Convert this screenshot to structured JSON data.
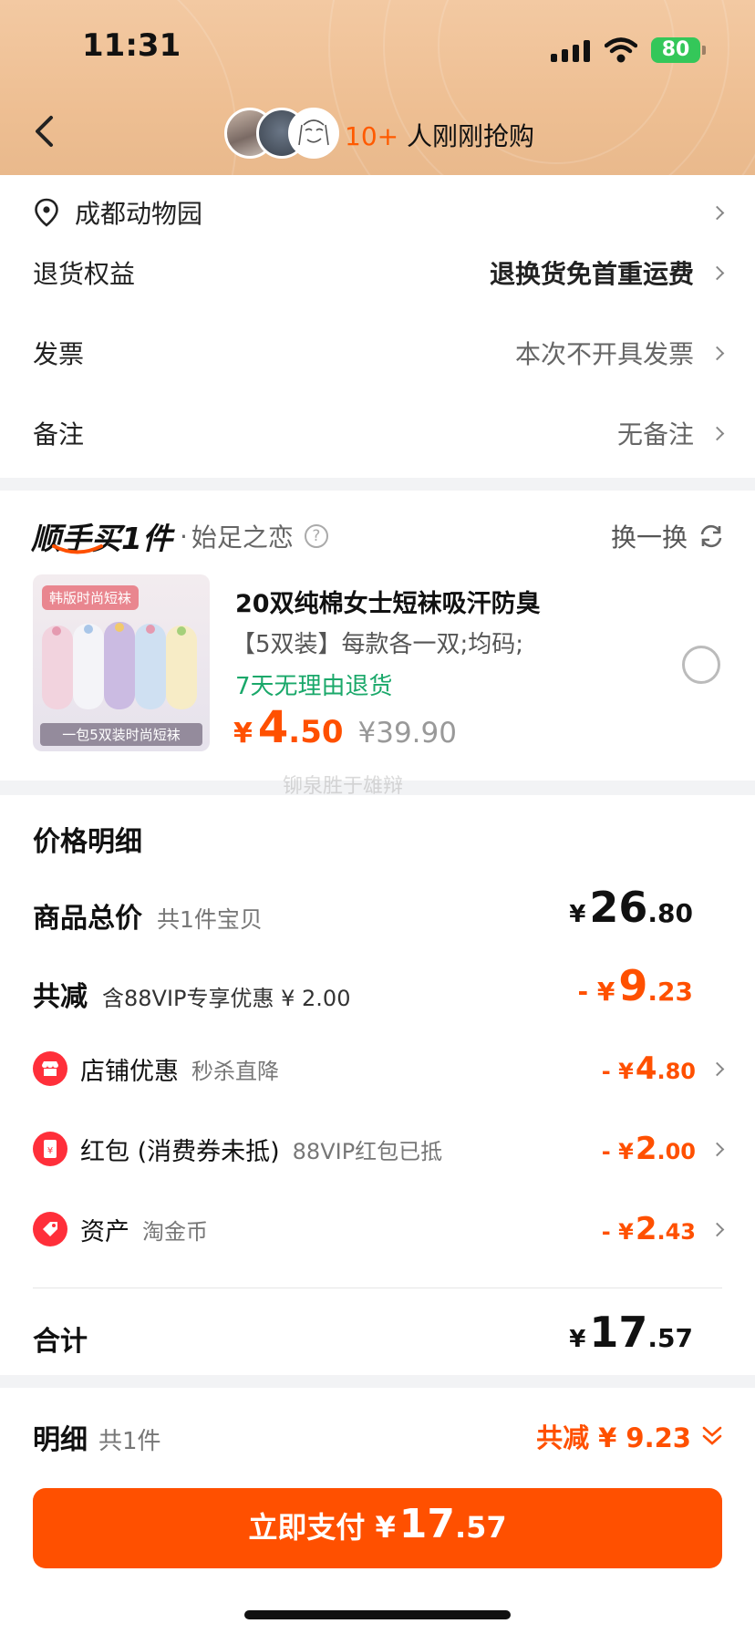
{
  "status_bar": {
    "time": "11:31",
    "battery": "80"
  },
  "header": {
    "count_highlight": "10+",
    "count_text": " 人刚刚抢购"
  },
  "address": {
    "name": "成都动物园"
  },
  "rows": [
    {
      "label": "退货权益",
      "value": "退换货免首重运费"
    },
    {
      "label": "发票",
      "value": "本次不开具发票"
    },
    {
      "label": "备注",
      "value": "无备注"
    }
  ],
  "addon": {
    "title": "顺手买1件",
    "shop": "始足之恋",
    "refresh_label": "换一换",
    "product": {
      "image_banner": "韩版时尚短袜",
      "image_bottom": "一包5双装时尚短袜",
      "title": "20双纯棉女士短袜吸汗防臭",
      "spec": "【5双装】每款各一双;均码;",
      "tag": "7天无理由退货",
      "price_symbol": "¥",
      "price_int": "4",
      "price_dec": ".50",
      "original_price": "¥39.90"
    },
    "watermark": "铆泉胜于雄辩"
  },
  "price_detail": {
    "title": "价格明细",
    "total_label": "商品总价",
    "total_sub": "共1件宝贝",
    "total_symbol": "¥",
    "total_int": "26",
    "total_dec": ".80",
    "reduce_label": "共减",
    "reduce_sub": "含88VIP专享优惠 ¥ 2.00",
    "reduce_prefix": "- ¥",
    "reduce_int": "9",
    "reduce_dec": ".23",
    "items": [
      {
        "label": "店铺优惠",
        "sub": "秒杀直降",
        "prefix": "- ¥",
        "int": "4",
        "dec": ".80",
        "icon": "shop-icon"
      },
      {
        "label": "红包 (消费券未抵)",
        "sub": "88VIP红包已抵",
        "prefix": "- ¥",
        "int": "2",
        "dec": ".00",
        "icon": "red-packet-icon"
      },
      {
        "label": "资产",
        "sub": "淘金币",
        "prefix": "- ¥",
        "int": "2",
        "dec": ".43",
        "icon": "coin-tag-icon"
      }
    ],
    "sum_label": "合计",
    "sum_symbol": "¥",
    "sum_int": "17",
    "sum_dec": ".57"
  },
  "footer": {
    "detail_label": "明细",
    "detail_count": "共1件",
    "reduce_summary": "共减 ¥ 9.23",
    "pay_text": "立即支付 ¥",
    "pay_int": "17",
    "pay_dec": ".57"
  },
  "colors": {
    "accent": "#ff5000",
    "green": "#1aa86a",
    "header_bg": "#eebf93"
  }
}
